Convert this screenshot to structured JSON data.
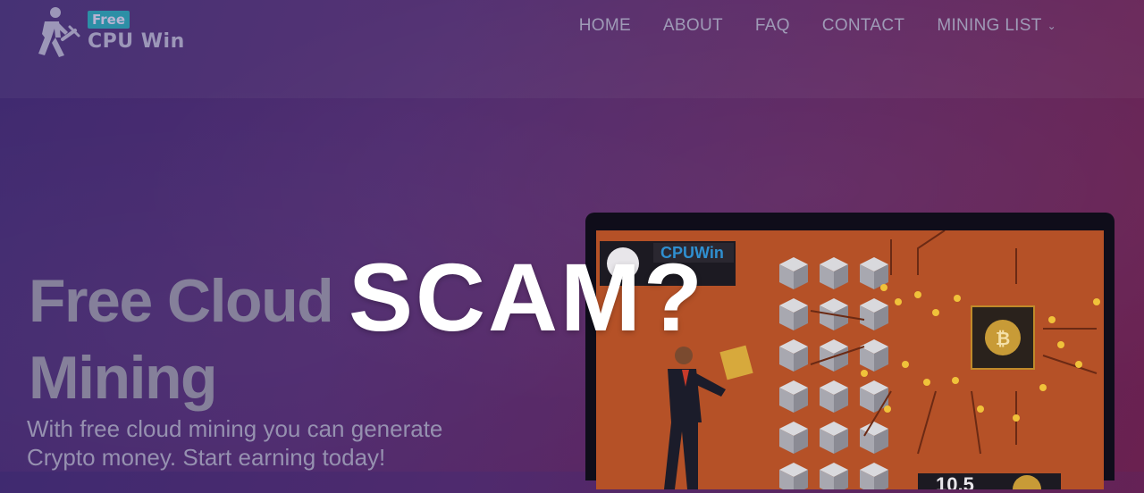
{
  "logo": {
    "badge": "Free",
    "name": "CPU Win"
  },
  "nav": {
    "items": [
      {
        "label": "HOME"
      },
      {
        "label": "ABOUT"
      },
      {
        "label": "FAQ"
      },
      {
        "label": "CONTACT"
      },
      {
        "label": "MINING LIST",
        "has_dropdown": true
      }
    ]
  },
  "hero": {
    "title": "Free Cloud Mining",
    "subtitle": "With free cloud mining you can generate Crypto money. Start earning today!"
  },
  "illustration": {
    "panel_label": "CPUWin",
    "counter_text": "10.5",
    "coin_symbol": "₿"
  },
  "overlay": {
    "text": "SCAM?"
  },
  "colors": {
    "background_start": "#3f2a70",
    "background_end": "#6a2150",
    "illustration_bg": "#b55127",
    "overlay_text": "#ffffff"
  }
}
